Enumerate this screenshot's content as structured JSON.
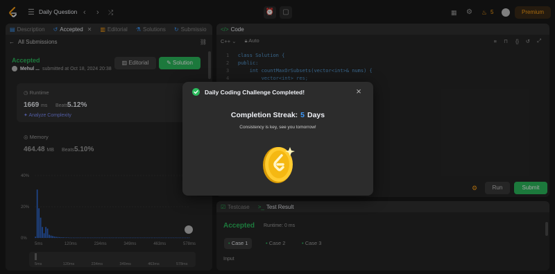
{
  "topbar": {
    "title": "Daily Question",
    "streak_count": "5",
    "premium_label": "Premium"
  },
  "left_panel": {
    "tabs": [
      {
        "label": "Description"
      },
      {
        "label": "Accepted"
      },
      {
        "label": "Editorial"
      },
      {
        "label": "Solutions"
      },
      {
        "label": "Submissio"
      }
    ],
    "back_label": "All Submissions",
    "status": "Accepted",
    "author": "Mehul ...",
    "submitted": "submitted at Oct 18, 2024 20:38",
    "editorial_button": "Editorial",
    "solution_button": "Solution",
    "runtime": {
      "label": "Runtime",
      "value": "1669",
      "unit": "ms",
      "beats_label": "Beats",
      "beats_value": "5.12%",
      "analyze_label": "Analyze Complexity"
    },
    "memory": {
      "label": "Memory",
      "value": "464.48",
      "unit": "MB",
      "beats_label": "Beats",
      "beats_value": "5.10%"
    }
  },
  "chart_data": {
    "type": "bar",
    "y_tick_labels": [
      "40%",
      "20%",
      "0%"
    ],
    "ylim": [
      0,
      40
    ],
    "x_tick_labels": [
      "5ms",
      "120ms",
      "234ms",
      "349ms",
      "463ms",
      "578ms"
    ],
    "values": [
      0.8,
      31,
      19,
      13,
      7,
      3,
      7,
      6,
      2,
      1.5,
      1.2,
      0.9,
      0.7,
      0.6,
      0.5,
      0.4,
      0.4,
      0.3,
      0.3,
      0.3,
      0.2,
      0.2,
      0.2,
      0.2,
      0.2,
      0.2,
      0.2,
      0.2,
      0.2,
      0.2,
      0.2,
      0.2,
      0.2,
      0.2,
      0.2,
      0.2,
      0.2,
      0.2,
      0.2,
      0.2,
      0.2,
      0.2,
      0.2,
      0.2,
      0.2,
      0.2,
      0.2,
      0.2,
      0.2,
      0.2,
      0.2,
      0.2,
      0.2,
      0.2,
      0.2,
      0.2,
      0.2,
      0.2,
      0.2,
      0.2,
      0.2,
      0.2,
      0.2,
      0.2,
      0.2,
      0.2,
      0.2,
      0.2,
      0.2,
      0.2,
      0.2,
      0.2,
      0.2,
      0.2,
      0.2,
      0.2,
      0.2,
      0.2,
      0.2,
      0.2,
      0.2,
      0.2,
      0.2,
      0.2,
      0.2,
      0.2,
      0.2,
      0.2,
      0.2,
      0.2
    ],
    "bar_color": "#2f6bd6"
  },
  "right_panel": {
    "code_tab": "Code",
    "language": "C++",
    "auto_label": "Auto",
    "code_lines": [
      {
        "n": "1",
        "text": "class Solution {"
      },
      {
        "n": "2",
        "text": "public:"
      },
      {
        "n": "3",
        "text": "    int countMaxOrSubsets(vector<int>& nums) {"
      },
      {
        "n": "4",
        "text": "        vector<int> res;"
      }
    ],
    "run_label": "Run",
    "submit_label": "Submit",
    "testcase_tab": "Testcase",
    "result_tab": "Test Result",
    "result_status": "Accepted",
    "result_runtime": "Runtime: 0 ms",
    "cases": [
      "Case 1",
      "Case 2",
      "Case 3"
    ],
    "input_label": "Input"
  },
  "modal": {
    "title": "Daily Coding Challenge Completed!",
    "streak_prefix": "Completion Streak:",
    "streak_value": "5",
    "streak_suffix": "Days",
    "subtitle": "Consistency is key, see you tomorrow!"
  },
  "colors": {
    "accent_green": "#2cbb5d",
    "accent_orange": "#ffa116",
    "streak_blue": "#3e9bff"
  }
}
